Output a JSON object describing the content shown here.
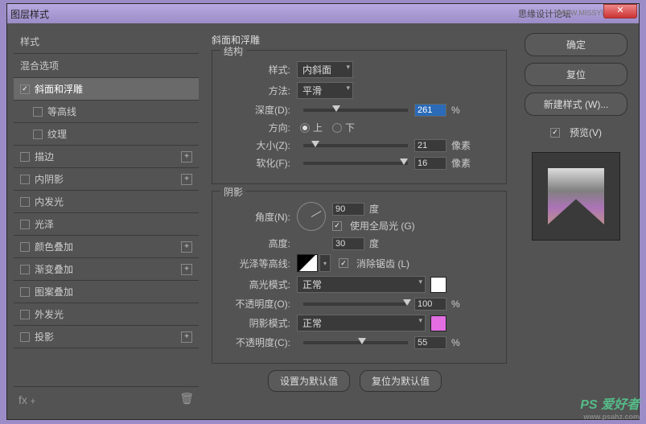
{
  "window": {
    "title": "图层样式",
    "forum": "思缘设计论坛",
    "url": "WWW.MISSYUAN.COM"
  },
  "sidebar": {
    "header1": "样式",
    "header2": "混合选项",
    "items": [
      {
        "label": "斜面和浮雕",
        "checked": true,
        "active": true
      },
      {
        "label": "等高线",
        "checked": false,
        "sub": true
      },
      {
        "label": "纹理",
        "checked": false,
        "sub": true
      },
      {
        "label": "描边",
        "checked": false,
        "add": true
      },
      {
        "label": "内阴影",
        "checked": false,
        "add": true
      },
      {
        "label": "内发光",
        "checked": false
      },
      {
        "label": "光泽",
        "checked": false
      },
      {
        "label": "颜色叠加",
        "checked": false,
        "add": true
      },
      {
        "label": "渐变叠加",
        "checked": false,
        "add": true
      },
      {
        "label": "图案叠加",
        "checked": false
      },
      {
        "label": "外发光",
        "checked": false
      },
      {
        "label": "投影",
        "checked": false,
        "add": true
      }
    ]
  },
  "main": {
    "title": "斜面和浮雕",
    "structure": {
      "legend": "结构",
      "style_lbl": "样式:",
      "style_val": "内斜面",
      "technique_lbl": "方法:",
      "technique_val": "平滑",
      "depth_lbl": "深度(D):",
      "depth_val": "261",
      "depth_unit": "%",
      "direction_lbl": "方向:",
      "up": "上",
      "down": "下",
      "size_lbl": "大小(Z):",
      "size_val": "21",
      "size_unit": "像素",
      "soften_lbl": "软化(F):",
      "soften_val": "16",
      "soften_unit": "像素"
    },
    "shading": {
      "legend": "阴影",
      "angle_lbl": "角度(N):",
      "angle_val": "90",
      "angle_unit": "度",
      "global_light": "使用全局光 (G)",
      "altitude_lbl": "高度:",
      "altitude_val": "30",
      "altitude_unit": "度",
      "gloss_lbl": "光泽等高线:",
      "antialias": "消除锯齿 (L)",
      "hilite_mode_lbl": "高光模式:",
      "hilite_mode_val": "正常",
      "hilite_opacity_lbl": "不透明度(O):",
      "hilite_opacity_val": "100",
      "hilite_opacity_unit": "%",
      "shadow_mode_lbl": "阴影模式:",
      "shadow_mode_val": "正常",
      "shadow_opacity_lbl": "不透明度(C):",
      "shadow_opacity_val": "55",
      "shadow_opacity_unit": "%"
    },
    "make_default": "设置为默认值",
    "reset_default": "复位为默认值"
  },
  "right": {
    "ok": "确定",
    "cancel": "复位",
    "new_style": "新建样式 (W)...",
    "preview": "预览(V)"
  },
  "watermark": {
    "brand": "PS 爱好者",
    "site": "www.psahz.com"
  }
}
